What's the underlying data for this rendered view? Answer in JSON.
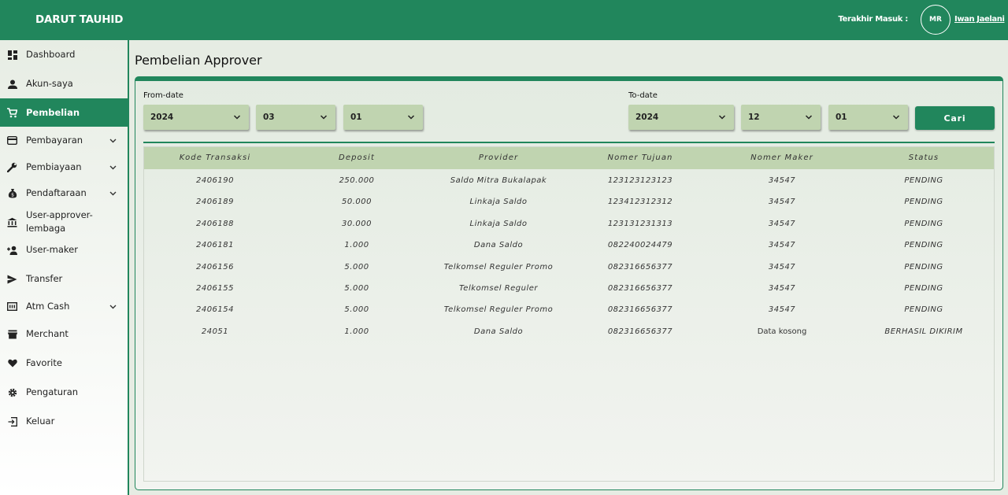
{
  "app": {
    "brand": "DARUT TAUHID",
    "last_login_label": "Terakhir Masuk :",
    "avatar_initials": "MR",
    "username": "Iwan Jaelani",
    "accent_color": "#21865c",
    "table_header_color": "#c0d4b0"
  },
  "sidebar": {
    "items": [
      {
        "label": "Dashboard",
        "icon": "dashboard-icon"
      },
      {
        "label": "Akun-saya",
        "icon": "person-icon"
      },
      {
        "label": "Pembelian",
        "icon": "cart-icon",
        "active": true
      },
      {
        "label": "Pembayaran",
        "icon": "wallet-icon",
        "expandable": true
      },
      {
        "label": "Pembiayaan",
        "icon": "wrench-icon",
        "expandable": true
      },
      {
        "label": "Pendaftaraan",
        "icon": "money-bag-icon",
        "expandable": true
      },
      {
        "label": "User-approver-lembaga",
        "icon": "bank-icon"
      },
      {
        "label": "User-maker",
        "icon": "person-add-icon"
      },
      {
        "label": "Transfer",
        "icon": "send-icon"
      },
      {
        "label": "Atm Cash",
        "icon": "atm-icon",
        "expandable": true
      },
      {
        "label": "Merchant",
        "icon": "store-icon"
      },
      {
        "label": "Favorite",
        "icon": "heart-icon"
      },
      {
        "label": "Pengaturan",
        "icon": "gear-icon"
      },
      {
        "label": "Keluar",
        "icon": "logout-icon"
      }
    ]
  },
  "page": {
    "title": "Pembelian Approver"
  },
  "filters": {
    "from_label": "From-date",
    "to_label": "To-date",
    "from_year": "2024",
    "from_month": "03",
    "from_day": "01",
    "to_year": "2024",
    "to_month": "12",
    "to_day": "01",
    "search_label": "Cari"
  },
  "table": {
    "columns": [
      "Kode Transaksi",
      "Deposit",
      "Provider",
      "Nomer Tujuan",
      "Nomer Maker",
      "Status"
    ],
    "rows": [
      [
        "2406190",
        "250.000",
        "Saldo Mitra Bukalapak",
        "123123123123",
        "34547",
        "PENDING"
      ],
      [
        "2406189",
        "50.000",
        "Linkaja Saldo",
        "123412312312",
        "34547",
        "PENDING"
      ],
      [
        "2406188",
        "30.000",
        "Linkaja Saldo",
        "123131231313",
        "34547",
        "PENDING"
      ],
      [
        "2406181",
        "1.000",
        "Dana Saldo",
        "082240024479",
        "34547",
        "PENDING"
      ],
      [
        "2406156",
        "5.000",
        "Telkomsel Reguler Promo",
        "082316656377",
        "34547",
        "PENDING"
      ],
      [
        "2406155",
        "5.000",
        "Telkomsel Reguler",
        "082316656377",
        "34547",
        "PENDING"
      ],
      [
        "2406154",
        "5.000",
        "Telkomsel Reguler Promo",
        "082316656377",
        "34547",
        "PENDING"
      ],
      [
        "24051",
        "1.000",
        "Dana Saldo",
        "082316656377",
        "Data kosong",
        "BERHASIL DIKIRIM"
      ]
    ]
  }
}
